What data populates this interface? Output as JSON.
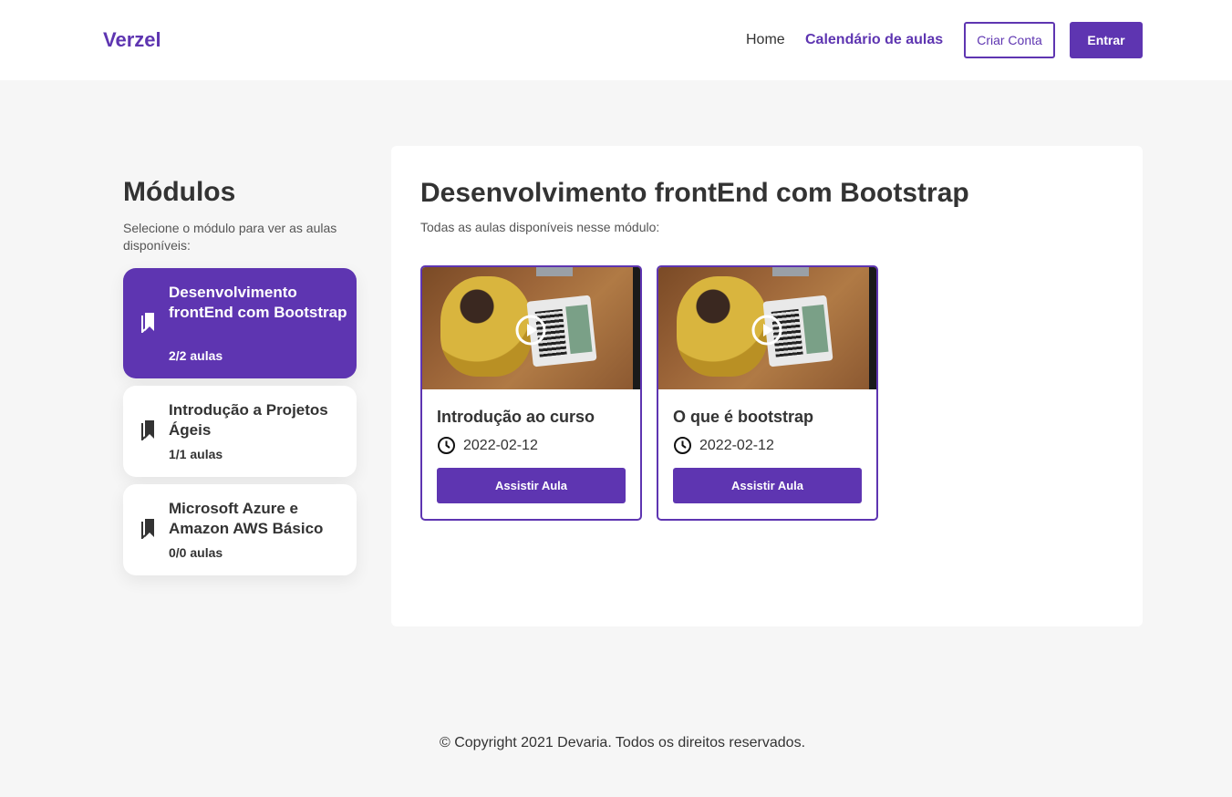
{
  "header": {
    "logo": "Verzel",
    "nav": {
      "home": "Home",
      "calendar": "Calendário de aulas"
    },
    "create_account": "Criar Conta",
    "login": "Entrar"
  },
  "sidebar": {
    "title": "Módulos",
    "subtitle": "Selecione o módulo para ver as aulas disponíveis:",
    "modules": [
      {
        "title": "Desenvolvimento frontEnd com Bootstrap",
        "count": "2/2 aulas",
        "active": true,
        "icon": "bookmark-icon"
      },
      {
        "title": "Introdução a Projetos Ágeis",
        "count": "1/1 aulas",
        "active": false,
        "icon": "bookmark-icon"
      },
      {
        "title": "Microsoft Azure e Amazon AWS Básico",
        "count": "0/0 aulas",
        "active": false,
        "icon": "bookmark-icon"
      }
    ]
  },
  "main": {
    "title": "Desenvolvimento frontEnd com Bootstrap",
    "subtitle": "Todas as aulas disponíveis nesse módulo:",
    "lessons": [
      {
        "title": "Introdução ao curso",
        "date": "2022-02-12",
        "button": "Assistir Aula"
      },
      {
        "title": "O que é bootstrap",
        "date": "2022-02-12",
        "button": "Assistir Aula"
      }
    ]
  },
  "footer": {
    "text": "© Copyright 2021 Devaria. Todos os direitos reservados."
  },
  "colors": {
    "brand": "#5e35b1",
    "background": "#f6f6f6",
    "card": "#ffffff"
  }
}
